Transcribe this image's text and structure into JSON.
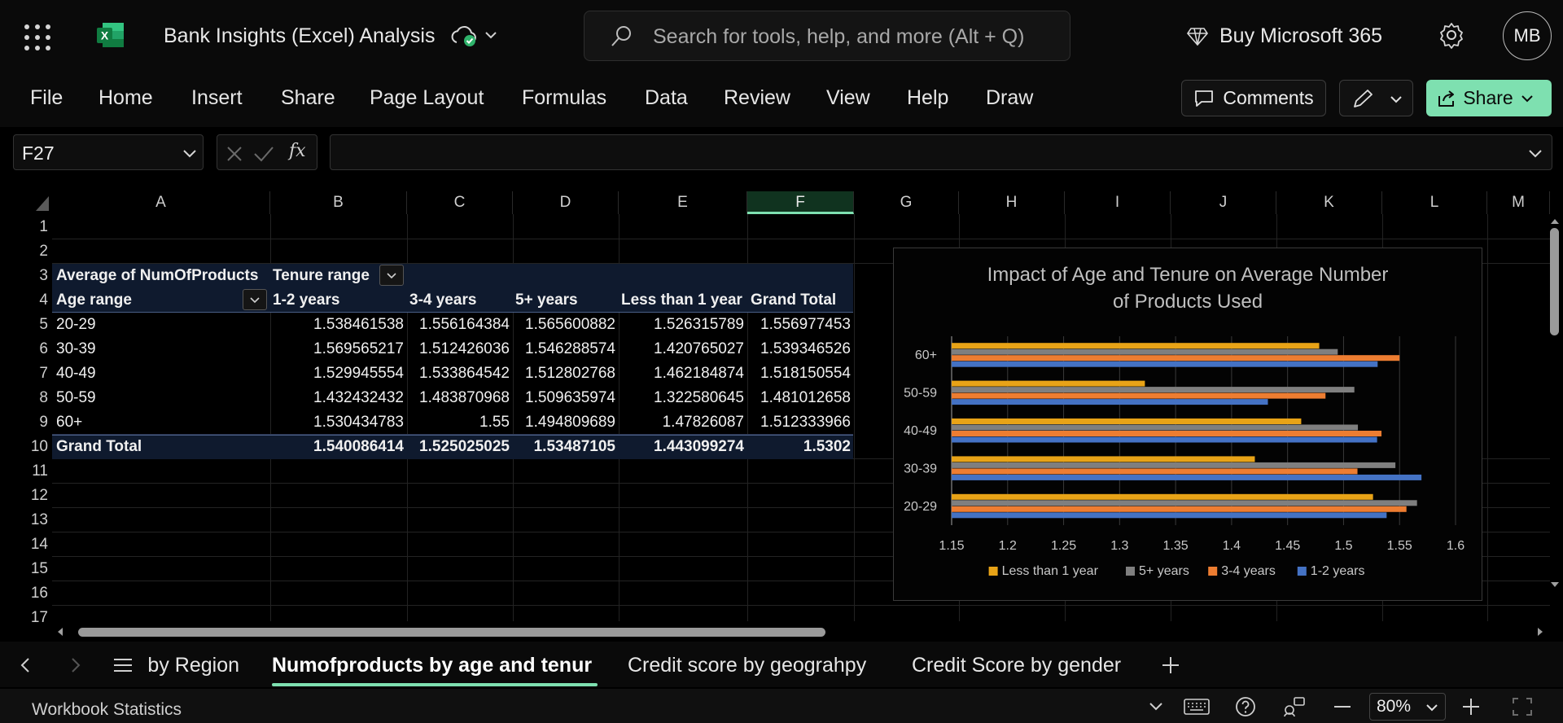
{
  "app": {
    "doc_title": "Bank Insights (Excel) Analysis",
    "search_placeholder": "Search for tools, help, and more (Alt + Q)",
    "buy_label": "Buy Microsoft 365",
    "avatar_initials": "MB"
  },
  "ribbon": {
    "tabs": [
      "File",
      "Home",
      "Insert",
      "Share",
      "Page Layout",
      "Formulas",
      "Data",
      "Review",
      "View",
      "Help",
      "Draw"
    ],
    "comments_label": "Comments",
    "share_label": "Share"
  },
  "formula_bar": {
    "name_box": "F27",
    "fx_symbol": "fx",
    "formula": ""
  },
  "grid": {
    "columns": [
      "A",
      "B",
      "C",
      "D",
      "E",
      "F",
      "G",
      "H",
      "I",
      "J",
      "K",
      "L",
      "M"
    ],
    "selected_column": "F",
    "rows": [
      "1",
      "2",
      "3",
      "4",
      "5",
      "6",
      "7",
      "8",
      "9",
      "10",
      "11",
      "12",
      "13",
      "14",
      "15",
      "16",
      "17"
    ]
  },
  "pivot": {
    "value_label": "Average of NumOfProducts",
    "column_field": "Tenure range",
    "row_field": "Age range",
    "headers": [
      "1-2 years",
      "3-4 years",
      "5+ years",
      "Less than 1 year",
      "Grand Total"
    ],
    "rows": [
      {
        "label": "20-29",
        "values": [
          "1.538461538",
          "1.556164384",
          "1.565600882",
          "1.526315789",
          "1.556977453"
        ]
      },
      {
        "label": "30-39",
        "values": [
          "1.569565217",
          "1.512426036",
          "1.546288574",
          "1.420765027",
          "1.539346526"
        ]
      },
      {
        "label": "40-49",
        "values": [
          "1.529945554",
          "1.533864542",
          "1.512802768",
          "1.462184874",
          "1.518150554"
        ]
      },
      {
        "label": "50-59",
        "values": [
          "1.432432432",
          "1.483870968",
          "1.509635974",
          "1.322580645",
          "1.481012658"
        ]
      },
      {
        "label": "60+",
        "values": [
          "1.530434783",
          "1.55",
          "1.494809689",
          "1.47826087",
          "1.512333966"
        ]
      }
    ],
    "grand_total": {
      "label": "Grand Total",
      "values": [
        "1.540086414",
        "1.525025025",
        "1.53487105",
        "1.443099274",
        "1.5302"
      ]
    }
  },
  "chart_data": {
    "type": "bar",
    "orientation": "horizontal",
    "title": "Impact of Age and Tenure on Average Number of Products Used",
    "categories": [
      "20-29",
      "30-39",
      "40-49",
      "50-59",
      "60+"
    ],
    "series": [
      {
        "name": "Less than 1 year",
        "color": "#e8a317",
        "values": [
          1.526315789,
          1.420765027,
          1.462184874,
          1.322580645,
          1.47826087
        ]
      },
      {
        "name": "5+ years",
        "color": "#7f7f7f",
        "values": [
          1.565600882,
          1.546288574,
          1.512802768,
          1.509635974,
          1.494809689
        ]
      },
      {
        "name": "3-4 years",
        "color": "#ed7d31",
        "values": [
          1.556164384,
          1.512426036,
          1.533864542,
          1.483870968,
          1.55
        ]
      },
      {
        "name": "1-2 years",
        "color": "#4472c4",
        "values": [
          1.538461538,
          1.569565217,
          1.529945554,
          1.432432432,
          1.530434783
        ]
      }
    ],
    "xlim": [
      1.15,
      1.6
    ],
    "xticks": [
      "1.15",
      "1.2",
      "1.25",
      "1.3",
      "1.35",
      "1.4",
      "1.45",
      "1.5",
      "1.55",
      "1.6"
    ],
    "legend_position": "bottom",
    "grid": true
  },
  "sheets": {
    "tabs": [
      "by Region",
      "Numofproducts by age and tenur",
      "Credit score by geograhpy",
      "Credit Score by gender"
    ],
    "active": "Numofproducts by age and tenur"
  },
  "status": {
    "text": "Workbook Statistics",
    "zoom": "80%"
  },
  "colors": {
    "accent": "#7ee0b0",
    "excel_green": "#107c41"
  }
}
